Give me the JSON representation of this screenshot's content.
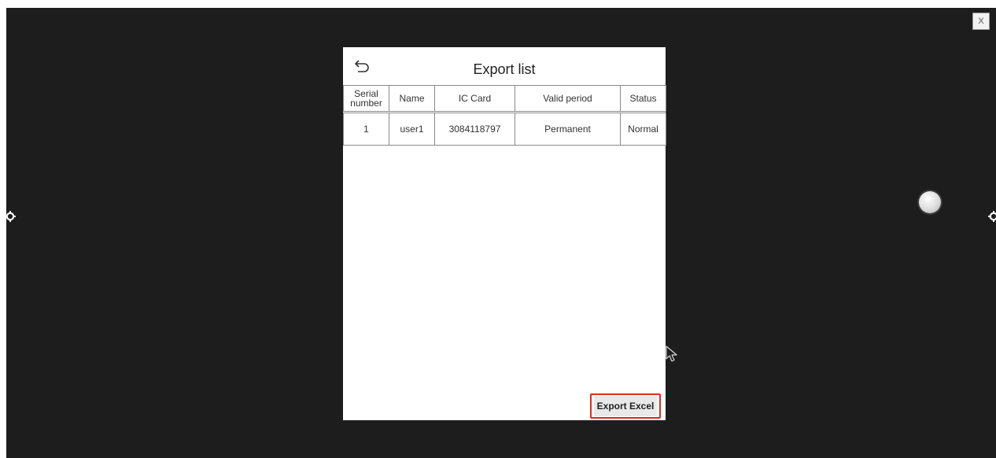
{
  "close_label": "X",
  "dialog": {
    "title": "Export list",
    "columns": [
      "Serial number",
      "Name",
      "IC Card",
      "Valid period",
      "Status"
    ],
    "rows": [
      [
        "1",
        "user1",
        "3084118797",
        "Permanent",
        "Normal"
      ]
    ],
    "export_button_label": "Export Excel"
  },
  "icons": {
    "back": "back-arrow-icon",
    "side_left": "gear-icon",
    "side_right": "gear-icon",
    "assistive": "floating-ball-icon",
    "pointer": "mouse-cursor-icon"
  },
  "colors": {
    "screen_background": "#1d1d1d",
    "panel_background": "#ffffff",
    "highlight_border": "#e0281e"
  }
}
